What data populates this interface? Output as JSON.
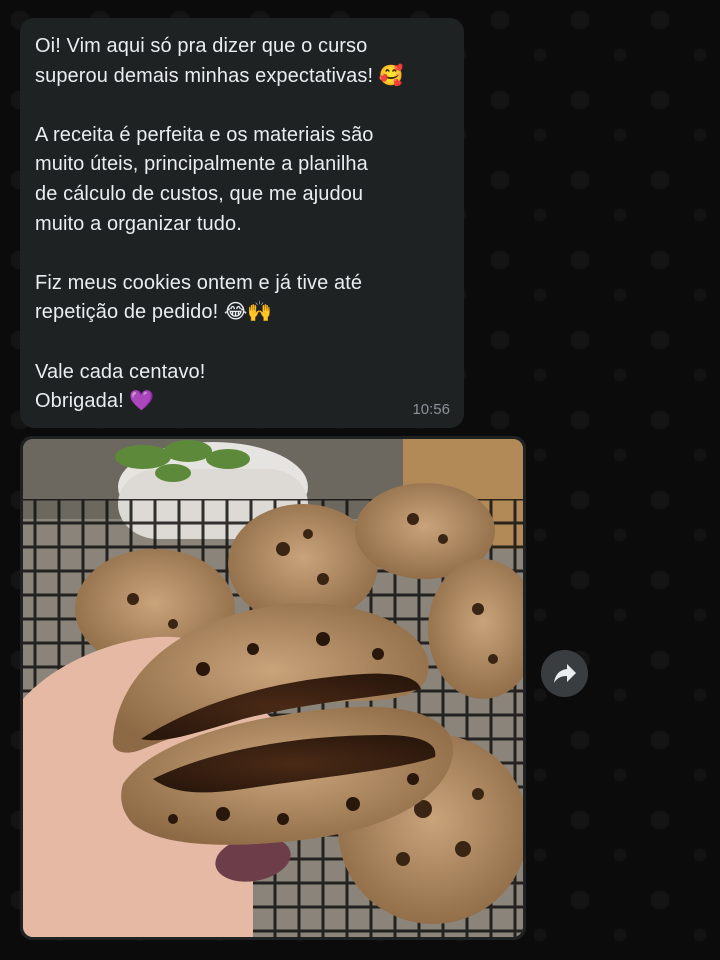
{
  "message": {
    "text": "Oi! Vim aqui só pra dizer que o curso\nsuperou demais minhas expectativas! 🥰\n\nA receita é perfeita e os materiais são\nmuito úteis, principalmente a planilha\nde cálculo de custos, que me ajudou\nmuito a organizar tudo.\n\nFiz meus cookies ontem e já tive até\nrepetição de pedido! 😂🙌\n\nVale cada centavo!\nObrigada! 💜",
    "time": "10:56"
  },
  "photo": {
    "subject": "cookie-photo"
  },
  "icons": {
    "forward": "forward-arrow-icon"
  },
  "colors": {
    "bubble": "#1f2223",
    "background": "#0b0b0b",
    "text": "#e9edef",
    "timestamp": "#8b9398"
  }
}
